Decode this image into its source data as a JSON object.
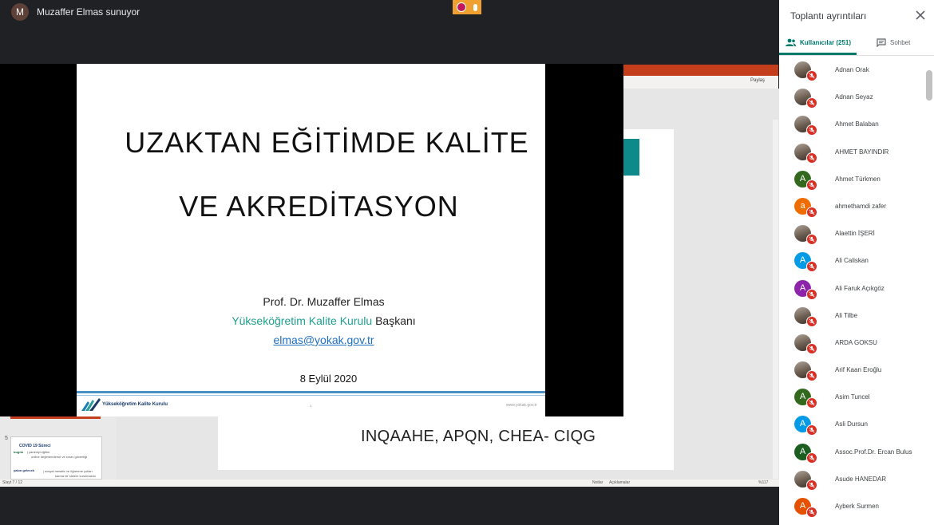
{
  "presenter": {
    "avatar_letter": "M",
    "text": "Muzaffer Elmas sunuyor"
  },
  "slide": {
    "title_line1": "UZAKTAN EĞİTİMDE KALİTE",
    "title_line2": "VE AKREDİTASYON",
    "author": "Prof. Dr. Muzaffer Elmas",
    "org_highlight": "Yükseköğretim Kalite Kurulu",
    "org_suffix": " Başkanı",
    "email": "elmas@yokak.gov.tr",
    "date": "8 Eylül 2020",
    "footer_org": "Yükseköğretim Kalite Kurulu",
    "page": "1",
    "url": "www.yokak.gov.tr"
  },
  "ppt": {
    "share_label": "Paylaş",
    "bottom_text": "INQAAHE, APQN,  CHEA- CIQG",
    "thumb_number": "5",
    "thumb_title": "COVID 19  Süreci",
    "thumb_line1": "bugün",
    "thumb_line1b": "| yanlmiyi eğitim",
    "thumb_line2": "online değerlendirme ve sınav güvenliği",
    "thumb_line3": "yakın gelecek",
    "thumb_line3b": "| sosyal mesafe ve öğrenme yolları",
    "thumb_line4": "karma bir sistem kurulmasını",
    "status_slide": "Slayt 7 / 12",
    "status_notes": "Notlar",
    "status_comments": "Açıklamalar",
    "status_zoom": "%117"
  },
  "panel": {
    "title": "Toplantı ayrıntıları",
    "tab_users": "Kullanıcılar (251)",
    "tab_chat": "Sohbet",
    "people": [
      {
        "name": "Adnan Orak",
        "letter": "",
        "color": "photo"
      },
      {
        "name": "Adnan Seyaz",
        "letter": "",
        "color": "photo"
      },
      {
        "name": "Ahmet Balaban",
        "letter": "",
        "color": "photo"
      },
      {
        "name": "AHMET BAYINDIR",
        "letter": "",
        "color": "photo"
      },
      {
        "name": "Ahmet Türkmen",
        "letter": "A",
        "color": "#33691e"
      },
      {
        "name": "ahmethamdi zafer",
        "letter": "a",
        "color": "#ef6c00"
      },
      {
        "name": "Alaettin İŞERİ",
        "letter": "",
        "color": "photo"
      },
      {
        "name": "Ali Caliskan",
        "letter": "A",
        "color": "#039be5"
      },
      {
        "name": "Ali Faruk Açıkgöz",
        "letter": "A",
        "color": "#8e24aa"
      },
      {
        "name": "Ali Tilbe",
        "letter": "",
        "color": "photo"
      },
      {
        "name": "ARDA GOKSU",
        "letter": "",
        "color": "photo"
      },
      {
        "name": "Arif Kaan Eroğlu",
        "letter": "",
        "color": "photo"
      },
      {
        "name": "Asim Tuncel",
        "letter": "A",
        "color": "#33691e"
      },
      {
        "name": "Asli Dursun",
        "letter": "A",
        "color": "#039be5"
      },
      {
        "name": "Assoc.Prof.Dr. Ercan Bulus",
        "letter": "A",
        "color": "#1b5e20"
      },
      {
        "name": "Asude HANEDAR",
        "letter": "",
        "color": "photo"
      },
      {
        "name": "Ayberk Surmen",
        "letter": "A",
        "color": "#e65100"
      }
    ]
  }
}
